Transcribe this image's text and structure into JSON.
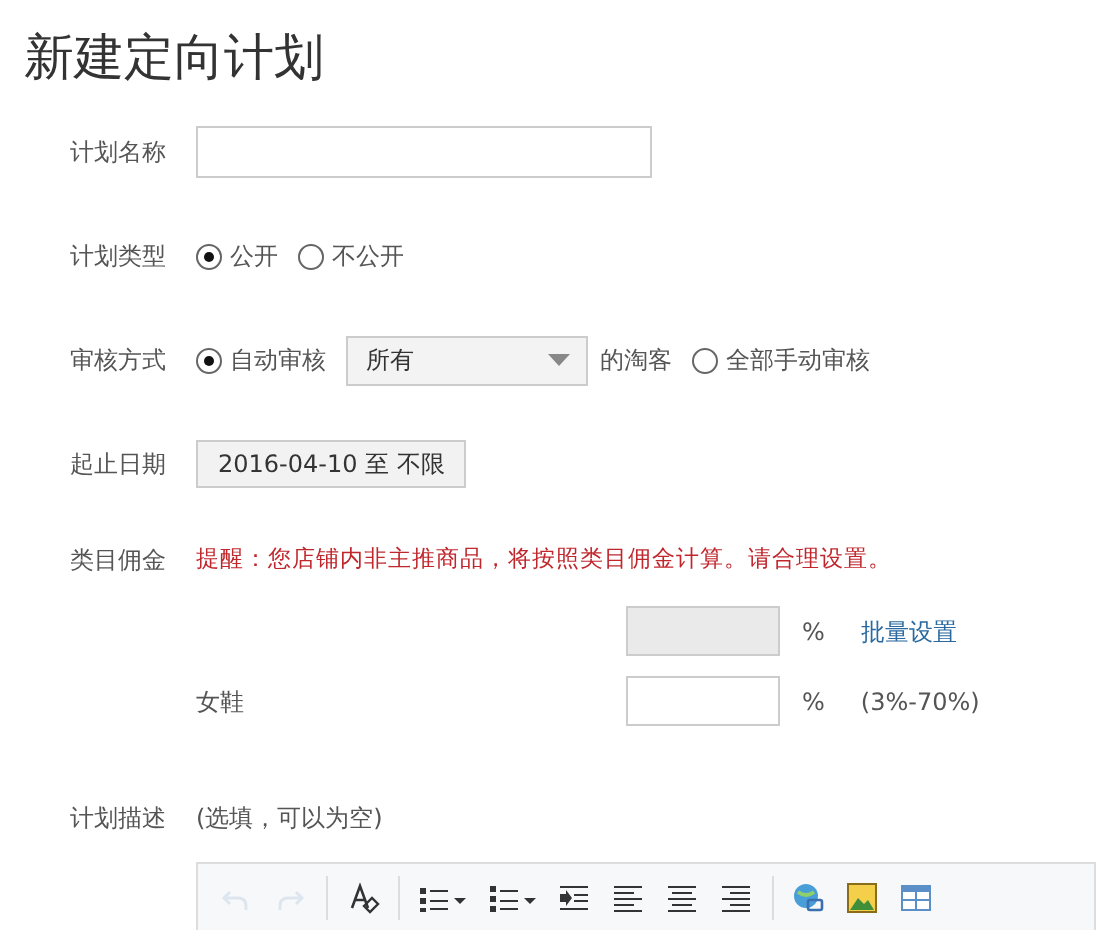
{
  "title": "新建定向计划",
  "fields": [
    {
      "kind": "text",
      "label": "计划名称"
    },
    {
      "kind": "radio",
      "label": "计划类型",
      "options": [
        {
          "label": "公开",
          "selected": true
        },
        {
          "label": "不公开",
          "selected": false
        }
      ]
    },
    {
      "kind": "audit",
      "label": "审核方式",
      "options": [
        {
          "label": "自动审核",
          "selected": true,
          "select_value": "所有",
          "suffix": "的淘客"
        },
        {
          "label": "全部手动审核",
          "selected": false
        }
      ]
    },
    {
      "kind": "date",
      "label": "起止日期",
      "value": "2016-04-10 至 不限"
    },
    {
      "kind": "commission",
      "label": "类目佣金",
      "notice": "提醒：您店铺内非主推商品，将按照类目佣金计算。请合理设置。",
      "batch": {
        "unit": "%",
        "link": "批量设置"
      },
      "rows": [
        {
          "category": "女鞋",
          "unit": "%",
          "range": "(3%-70%)"
        }
      ]
    },
    {
      "kind": "editor",
      "label": "计划描述",
      "hint": "(选填，可以为空)",
      "toolbar": [
        [
          {
            "kind": "undo",
            "disabled": true
          },
          {
            "kind": "redo",
            "disabled": true
          }
        ],
        [
          {
            "kind": "clear-format",
            "disabled": false
          }
        ],
        [
          {
            "kind": "bullet-list",
            "disabled": false
          },
          {
            "kind": "numbered-list",
            "disabled": false
          },
          {
            "kind": "indent",
            "disabled": false
          },
          {
            "kind": "align-left",
            "disabled": false
          },
          {
            "kind": "align-center",
            "disabled": false
          },
          {
            "kind": "align-right",
            "disabled": false
          }
        ],
        [
          {
            "kind": "link",
            "disabled": false
          },
          {
            "kind": "image",
            "disabled": false
          },
          {
            "kind": "table",
            "disabled": false
          }
        ]
      ]
    }
  ]
}
